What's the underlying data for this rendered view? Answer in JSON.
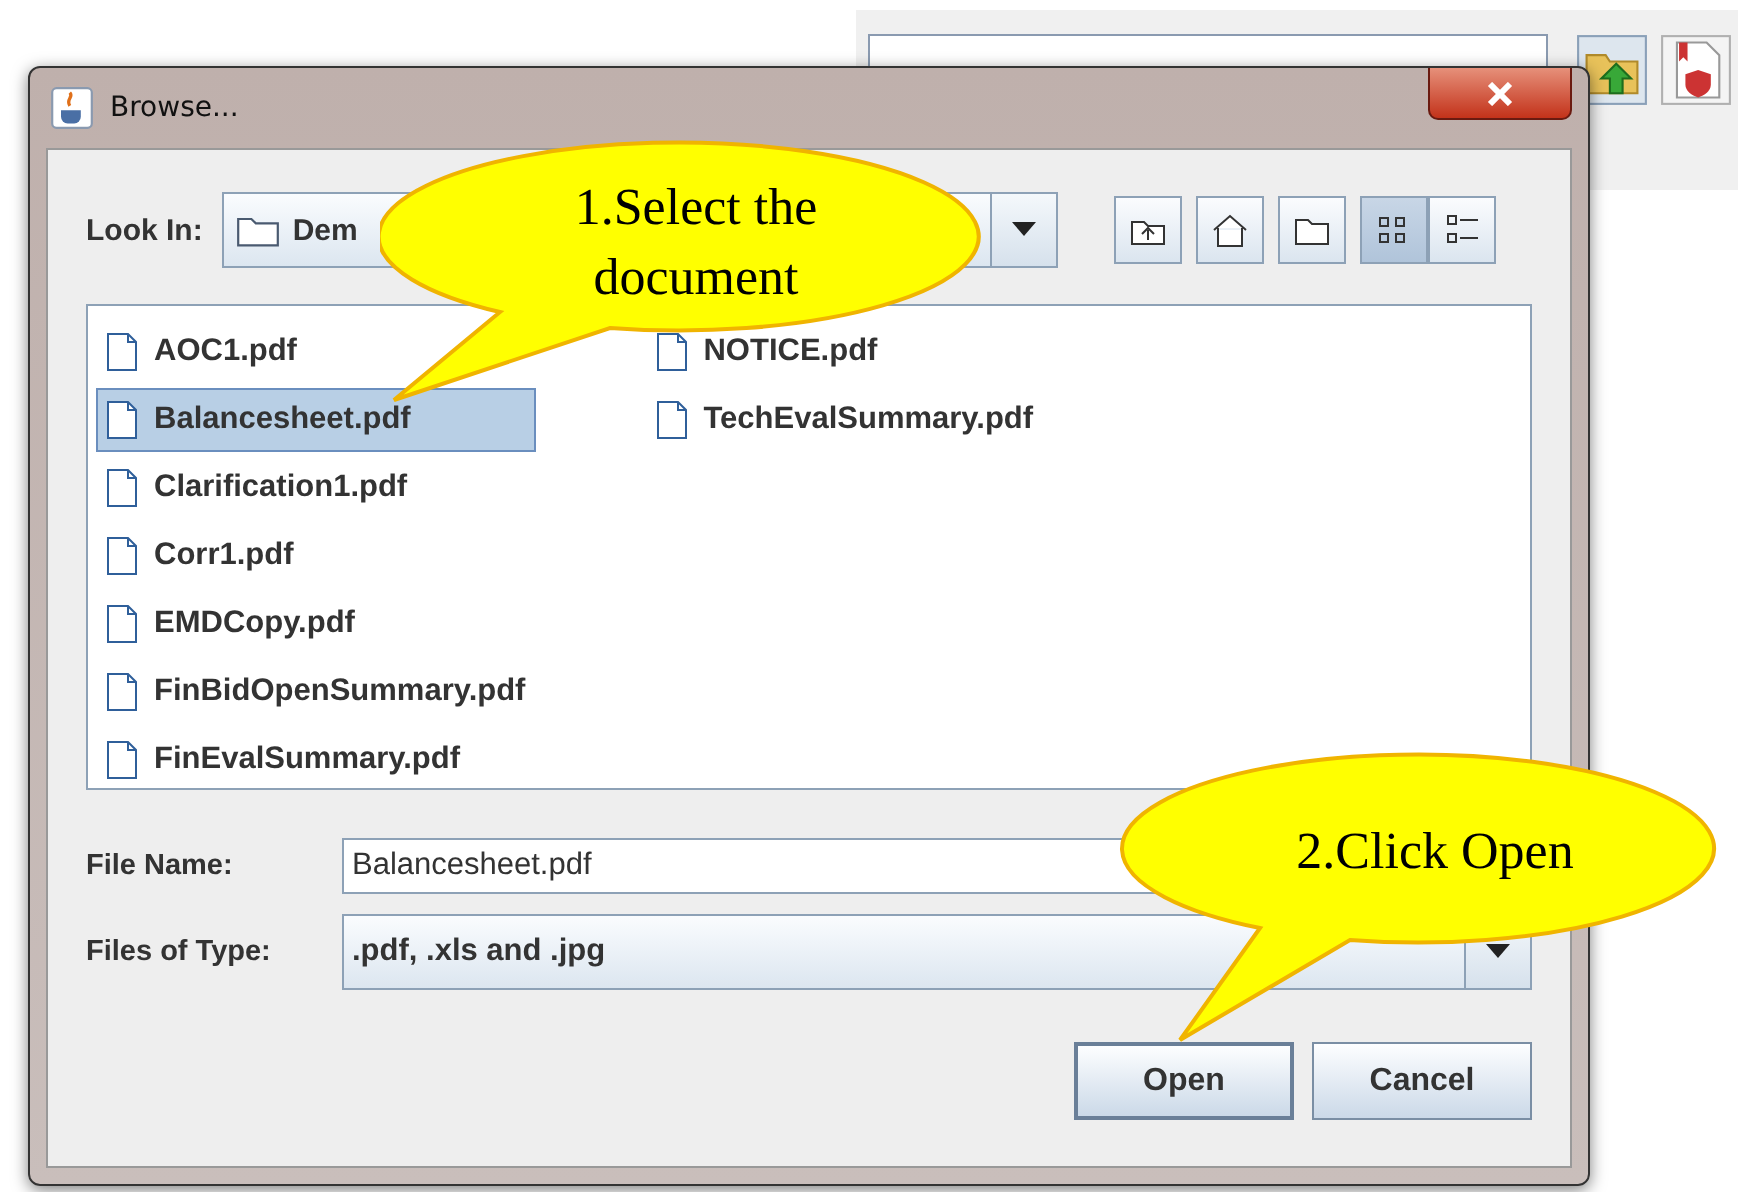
{
  "window": {
    "title": "Browse..."
  },
  "look_in": {
    "label": "Look In:",
    "value": "Dem"
  },
  "files": [
    {
      "name": "AOC1.pdf",
      "selected": false
    },
    {
      "name": "Balancesheet.pdf",
      "selected": true
    },
    {
      "name": "Clarification1.pdf",
      "selected": false
    },
    {
      "name": "Corr1.pdf",
      "selected": false
    },
    {
      "name": "EMDCopy.pdf",
      "selected": false
    },
    {
      "name": "FinBidOpenSummary.pdf",
      "selected": false
    },
    {
      "name": "FinEvalSummary.pdf",
      "selected": false
    },
    {
      "name": "NOTICE.pdf",
      "selected": false
    },
    {
      "name": "TechEvalSummary.pdf",
      "selected": false
    }
  ],
  "file_name": {
    "label": "File Name:",
    "value": "Balancesheet.pdf"
  },
  "files_of_type": {
    "label": "Files of Type:",
    "value": ".pdf, .xls and .jpg"
  },
  "buttons": [
    {
      "label": "Open",
      "default": true
    },
    {
      "label": "Cancel",
      "default": false
    }
  ],
  "callouts": [
    {
      "text": "1.Select the document"
    },
    {
      "text": "2.Click Open"
    }
  ]
}
